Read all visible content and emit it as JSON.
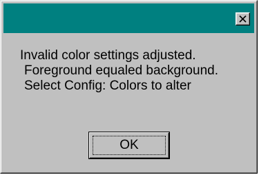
{
  "dialog": {
    "close_icon": "close-icon",
    "message_lines": [
      "Invalid color settings adjusted.",
      "Foreground equaled background.",
      "Select Config: Colors to alter"
    ],
    "ok_label": "OK"
  },
  "colors": {
    "title_bar": "#008080",
    "face": "#c0c0c0"
  }
}
